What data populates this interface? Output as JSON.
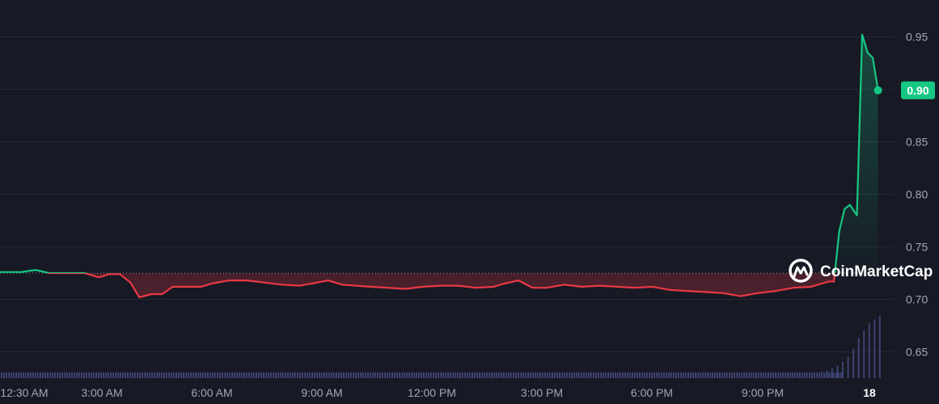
{
  "watermark": {
    "text": "CoinMarketCap"
  },
  "chart_data": {
    "type": "line",
    "x_ticks": [
      "12:30 AM",
      "3:00 AM",
      "6:00 AM",
      "9:00 AM",
      "12:00 PM",
      "3:00 PM",
      "6:00 PM",
      "9:00 PM",
      "18"
    ],
    "y_ticks": [
      "0.95",
      "0.90",
      "0.85",
      "0.80",
      "0.75",
      "0.70",
      "0.65"
    ],
    "ylim": [
      0.625,
      0.985
    ],
    "reference_price": 0.725,
    "current_price": {
      "label": "0.90",
      "value": 0.899
    },
    "x_range_hours": [
      0,
      25
    ],
    "grid": true,
    "colors": {
      "up": "#16c784",
      "down": "#ea3943",
      "volume": "#3d4370",
      "background": "#171924"
    },
    "price_series": {
      "x_hours": [
        0.0,
        0.6,
        1.0,
        1.4,
        1.9,
        2.4,
        2.8,
        3.1,
        3.4,
        3.7,
        3.95,
        4.3,
        4.6,
        4.9,
        5.3,
        5.7,
        6.0,
        6.5,
        7.0,
        7.5,
        8.0,
        8.5,
        9.0,
        9.3,
        9.7,
        10.1,
        10.5,
        11.0,
        11.5,
        12.0,
        12.5,
        13.0,
        13.5,
        14.0,
        14.3,
        14.7,
        15.1,
        15.5,
        16.0,
        16.5,
        17.0,
        17.5,
        18.0,
        18.5,
        19.0,
        19.5,
        20.0,
        20.5,
        21.0,
        21.5,
        22.0,
        22.5,
        23.0,
        23.3,
        23.5,
        23.65,
        23.8,
        23.95,
        24.1,
        24.3,
        24.45,
        24.6,
        24.75,
        24.9
      ],
      "values": [
        0.726,
        0.726,
        0.728,
        0.725,
        0.725,
        0.725,
        0.721,
        0.724,
        0.724,
        0.716,
        0.702,
        0.705,
        0.705,
        0.712,
        0.712,
        0.712,
        0.715,
        0.718,
        0.718,
        0.716,
        0.714,
        0.713,
        0.716,
        0.718,
        0.714,
        0.713,
        0.712,
        0.711,
        0.71,
        0.712,
        0.713,
        0.713,
        0.711,
        0.712,
        0.715,
        0.718,
        0.711,
        0.711,
        0.714,
        0.712,
        0.713,
        0.712,
        0.711,
        0.712,
        0.709,
        0.708,
        0.707,
        0.706,
        0.703,
        0.706,
        0.708,
        0.711,
        0.712,
        0.715,
        0.717,
        0.717,
        0.765,
        0.786,
        0.79,
        0.78,
        0.952,
        0.935,
        0.93,
        0.899
      ]
    },
    "volume_series": {
      "x_hours": [
        23.3,
        23.45,
        23.6,
        23.75,
        23.9,
        24.05,
        24.2,
        24.35,
        24.5,
        24.65,
        24.8,
        24.95
      ],
      "values": [
        2,
        4,
        8,
        14,
        22,
        32,
        48,
        70,
        85,
        100,
        108,
        115
      ]
    }
  }
}
